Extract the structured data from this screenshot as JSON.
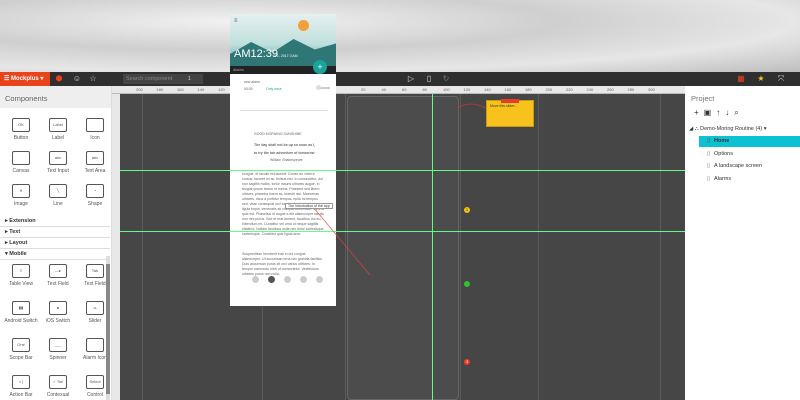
{
  "toolbar": {
    "app_name": "Mockplus",
    "search_placeholder": "Search component",
    "search_count": "1"
  },
  "ruler": {
    "ticks": [
      "200",
      "180",
      "160",
      "140",
      "120",
      "100",
      "80",
      "60",
      "40",
      "20",
      "20",
      "40",
      "60",
      "80",
      "100",
      "120",
      "140",
      "160",
      "180",
      "200",
      "220",
      "240",
      "260",
      "280",
      "300"
    ]
  },
  "components": {
    "title": "Components",
    "basic": [
      {
        "label": "Button",
        "glyph": "OK"
      },
      {
        "label": "Label",
        "glyph": "Label"
      },
      {
        "label": "Icon",
        "glyph": ""
      },
      {
        "label": "Canvas",
        "glyph": ""
      },
      {
        "label": "Text Input",
        "glyph": "abc"
      },
      {
        "label": "Text Area",
        "glyph": "abc"
      },
      {
        "label": "Image",
        "glyph": "✕"
      },
      {
        "label": "Line",
        "glyph": "╲"
      },
      {
        "label": "Shape",
        "glyph": "◔"
      }
    ],
    "sections": [
      "Extension",
      "Text",
      "Layout",
      "Mobile"
    ],
    "mobile": [
      {
        "label": "Table View",
        "glyph": "≡"
      },
      {
        "label": "Text Field",
        "glyph": "—▸"
      },
      {
        "label": "Text Field",
        "glyph": "Tab"
      },
      {
        "label": "Android Switch",
        "glyph": "▮▮"
      },
      {
        "label": "iOS Switch",
        "glyph": "●"
      },
      {
        "label": "Slider",
        "glyph": "-o-"
      },
      {
        "label": "Scope Bar",
        "glyph": "One"
      },
      {
        "label": "Spinner",
        "glyph": "___"
      },
      {
        "label": "Alarm Icon",
        "glyph": ""
      },
      {
        "label": "Action Bar",
        "glyph": "< |"
      },
      {
        "label": "Contexual",
        "glyph": "✓ Sel"
      },
      {
        "label": "Control",
        "glyph": "Select"
      }
    ]
  },
  "phone": {
    "time": "AM12:39",
    "date": "1 1, 2017 0 AM",
    "appbar": "Alarms",
    "fab": "+",
    "alarm_title": "new alarm",
    "alarm_time": "00:00",
    "alarm_repeat": "Only once",
    "heading": "GOOD MORNING SUNSHINE",
    "quote1": "The day shall not be up so soon as I,",
    "quote2": "to try the fair adventure of tomorrow",
    "author": "William Shakespeare",
    "body1": "congue, et iaculis est laoreet. Donec ac viverra cursus, laoreet mi ac, finibus nisl. In consectetur, dui non sagittis mollis, tortor mauris ultricies augue, in feugiat ipsum lectus ut metus. Praesent sed libero ultrices, pharetra lorem ac, blandit nisi. Maecenas ultricies, risus a porttitor tempus, nulla mi tempus sed, vitae consequat orci turpis vitae tortor. Integer ligula turpis, venenatis sit volutpat accumsan, viverra quis est. Phasellus id augue a elit ullamcorper iaculis non nec purus. Sed et erat laoreet, faucibus dui eu, bibendum mi. Curabitur vel urna ut neque sagittis eleifend. Nullam faucibus nulla nec dolor scelerisque scelerisque. Curabitur quis ligula arcu.",
    "body2": "Suspendisse hendrerit erat in dui congue ullamcorper. Ut accumsan urna nec gravida facilisis. Duis accumsan purus sit orci varius ultricies. In tempor commodo nibh ut consectetur. Vestibulum ultricies purus non nulla."
  },
  "annotations": {
    "note": "Move this slider...",
    "callout": "The introduction of the app",
    "dot_yellow": "1",
    "dot_red": "3"
  },
  "project": {
    "title": "Project",
    "root": "Demo-Moring Routine (4)",
    "pages": [
      "Home",
      "Options",
      "A landscape screen",
      "Alarms"
    ],
    "selected": "Home"
  },
  "colors": {
    "brand": "#e8431b",
    "accent": "#0cc2d2",
    "guide": "#5dff86"
  }
}
